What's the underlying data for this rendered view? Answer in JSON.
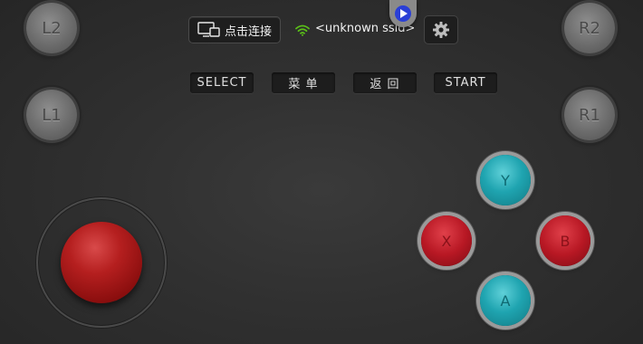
{
  "shoulder_buttons": {
    "l2": "L2",
    "l1": "L1",
    "r2": "R2",
    "r1": "R1"
  },
  "top_bar": {
    "connect_label": "点击连接",
    "ssid": "<unknown ssid>",
    "wifi_icon": "wifi-icon",
    "settings_icon": "gear-icon",
    "play_icon": "play-icon"
  },
  "menu_buttons": {
    "select": "SELECT",
    "menu": "菜 单",
    "back": "返 回",
    "start": "START"
  },
  "face_buttons": {
    "y": "Y",
    "x": "X",
    "b": "B",
    "a": "A"
  },
  "colors": {
    "background": "#303030",
    "cyan_button": "#1fa4b0",
    "red_button": "#b81824",
    "joystick": "#b51f1f",
    "wifi": "#5ac018"
  }
}
